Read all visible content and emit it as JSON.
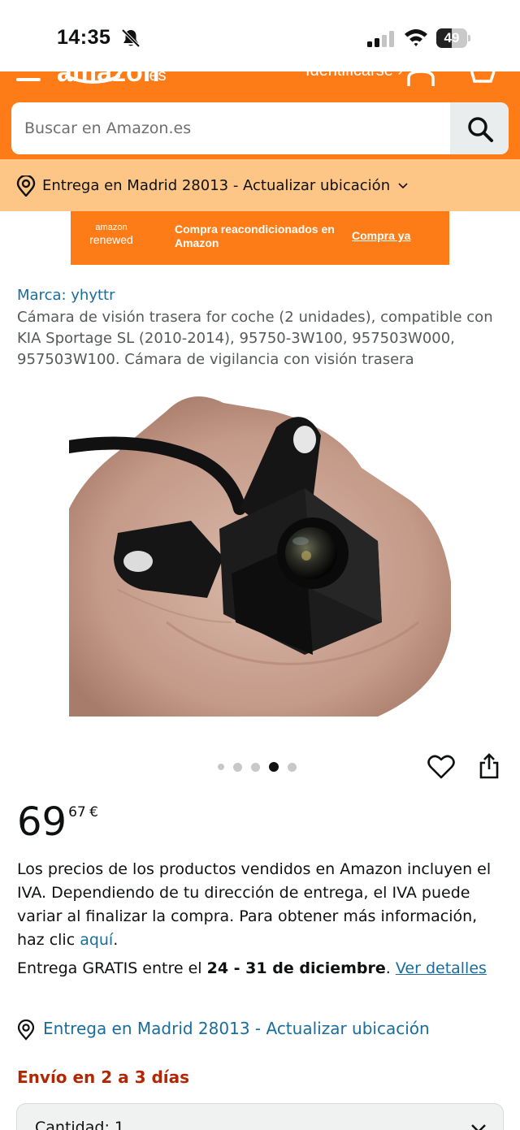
{
  "status_bar": {
    "time": "14:35",
    "battery_level": "49",
    "battery_fraction": 0.49,
    "icons": [
      "bell-slash-icon",
      "cellular-signal-icon",
      "wifi-icon",
      "battery-icon"
    ]
  },
  "header": {
    "logo_text": "amazon",
    "logo_suffix": ".es",
    "signin_text": "Identificarse ›",
    "icons": [
      "menu-icon",
      "user-icon",
      "cart-icon",
      "search-icon"
    ],
    "accent_color": "#fd7c18"
  },
  "search": {
    "placeholder": "Buscar en Amazon.es",
    "value": ""
  },
  "delivery_bar": {
    "text": "Entrega en Madrid 28013 - Actualizar ubicación",
    "background_color": "#fec686"
  },
  "banner": {
    "logo_top": "amazon",
    "logo_bottom": "renewed",
    "text": "Compra reacondicionados en Amazon",
    "link": "Compra ya"
  },
  "product": {
    "brand": "Marca: yhyttr",
    "title": "Cámara de visión trasera for coche (2 unidades), compatible con KIA Sportage SL (2010-2014), 95750-3W100, 957503W000, 957503W100. Cámara de vigilancia con visión trasera",
    "image_count": 5,
    "active_image_index": 3
  },
  "price": {
    "whole": "69",
    "fraction": "67",
    "currency": "€"
  },
  "vat": {
    "text": "Los precios de los productos vendidos en Amazon incluyen el IVA. Dependiendo de tu dirección de entrega, el IVA puede variar al finalizar la compra. Para obtener más información, haz clic ",
    "link": "aquí",
    "end": "."
  },
  "free_delivery": {
    "prefix": "Entrega GRATIS entre el ",
    "dates": "24 - 31 de diciembre",
    "suffix": ". ",
    "link": "Ver detalles"
  },
  "location": {
    "text": "Entrega en Madrid 28013 - Actualizar ubicación"
  },
  "shipping": {
    "text": "Envío en 2 a 3 días",
    "color": "#b12704"
  },
  "quantity": {
    "label": "Cantidad: 1"
  }
}
